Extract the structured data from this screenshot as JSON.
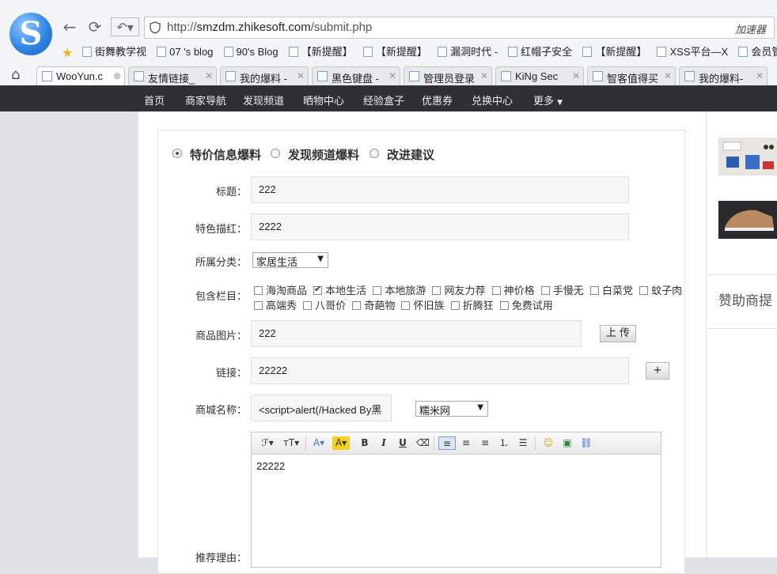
{
  "browser": {
    "url_prefix": "http://",
    "url_host": "smzdm.zhikesoft.com",
    "url_path": "/submit.php",
    "accelerator": "加速器",
    "bookmarks": [
      "街舞教学视",
      "07 's blog",
      "90's Blog",
      "【新提醒】",
      "【新提醒】",
      "漏洞时代 -",
      "红帽子安全",
      "【新提醒】",
      "XSS平台—X",
      "会员管理"
    ],
    "tabs": [
      "WooYun.c",
      "友情链接_",
      "我的爆料 -",
      "黑色键盘 -",
      "管理员登录",
      "KiNg Sec",
      "智客值得买",
      "我的爆料-"
    ]
  },
  "site_nav": [
    "首页",
    "商家导航",
    "发现频道",
    "晒物中心",
    "经验盒子",
    "优惠券",
    "兑换中心",
    "更多"
  ],
  "form": {
    "types": [
      "特价信息爆料",
      "发现频道爆料",
      "改进建议"
    ],
    "labels": {
      "title": "标题：",
      "highlight": "特色描红：",
      "category": "所属分类：",
      "columns": "包含栏目：",
      "image": "商品图片：",
      "link": "链接：",
      "mall": "商城名称：",
      "reason": "推荐理由："
    },
    "values": {
      "title": "222",
      "highlight": "2222",
      "category": "家居生活",
      "image": "222",
      "link": "22222",
      "mall": "<script>alert(/Hacked By黑",
      "mall_select": "糯米网",
      "editor_text": "22222"
    },
    "columns_row1": [
      "海淘商品",
      "本地生活",
      "本地旅游",
      "网友力荐",
      "神价格",
      "手慢无",
      "白菜党",
      "蚊子肉"
    ],
    "columns_row2": [
      "高端秀",
      "八哥价",
      "奇葩物",
      "怀旧族",
      "折腾狂",
      "免费试用"
    ],
    "upload_label": "上 传",
    "add_label": "+"
  },
  "sidebar": {
    "sponsor": "赞助商提"
  }
}
